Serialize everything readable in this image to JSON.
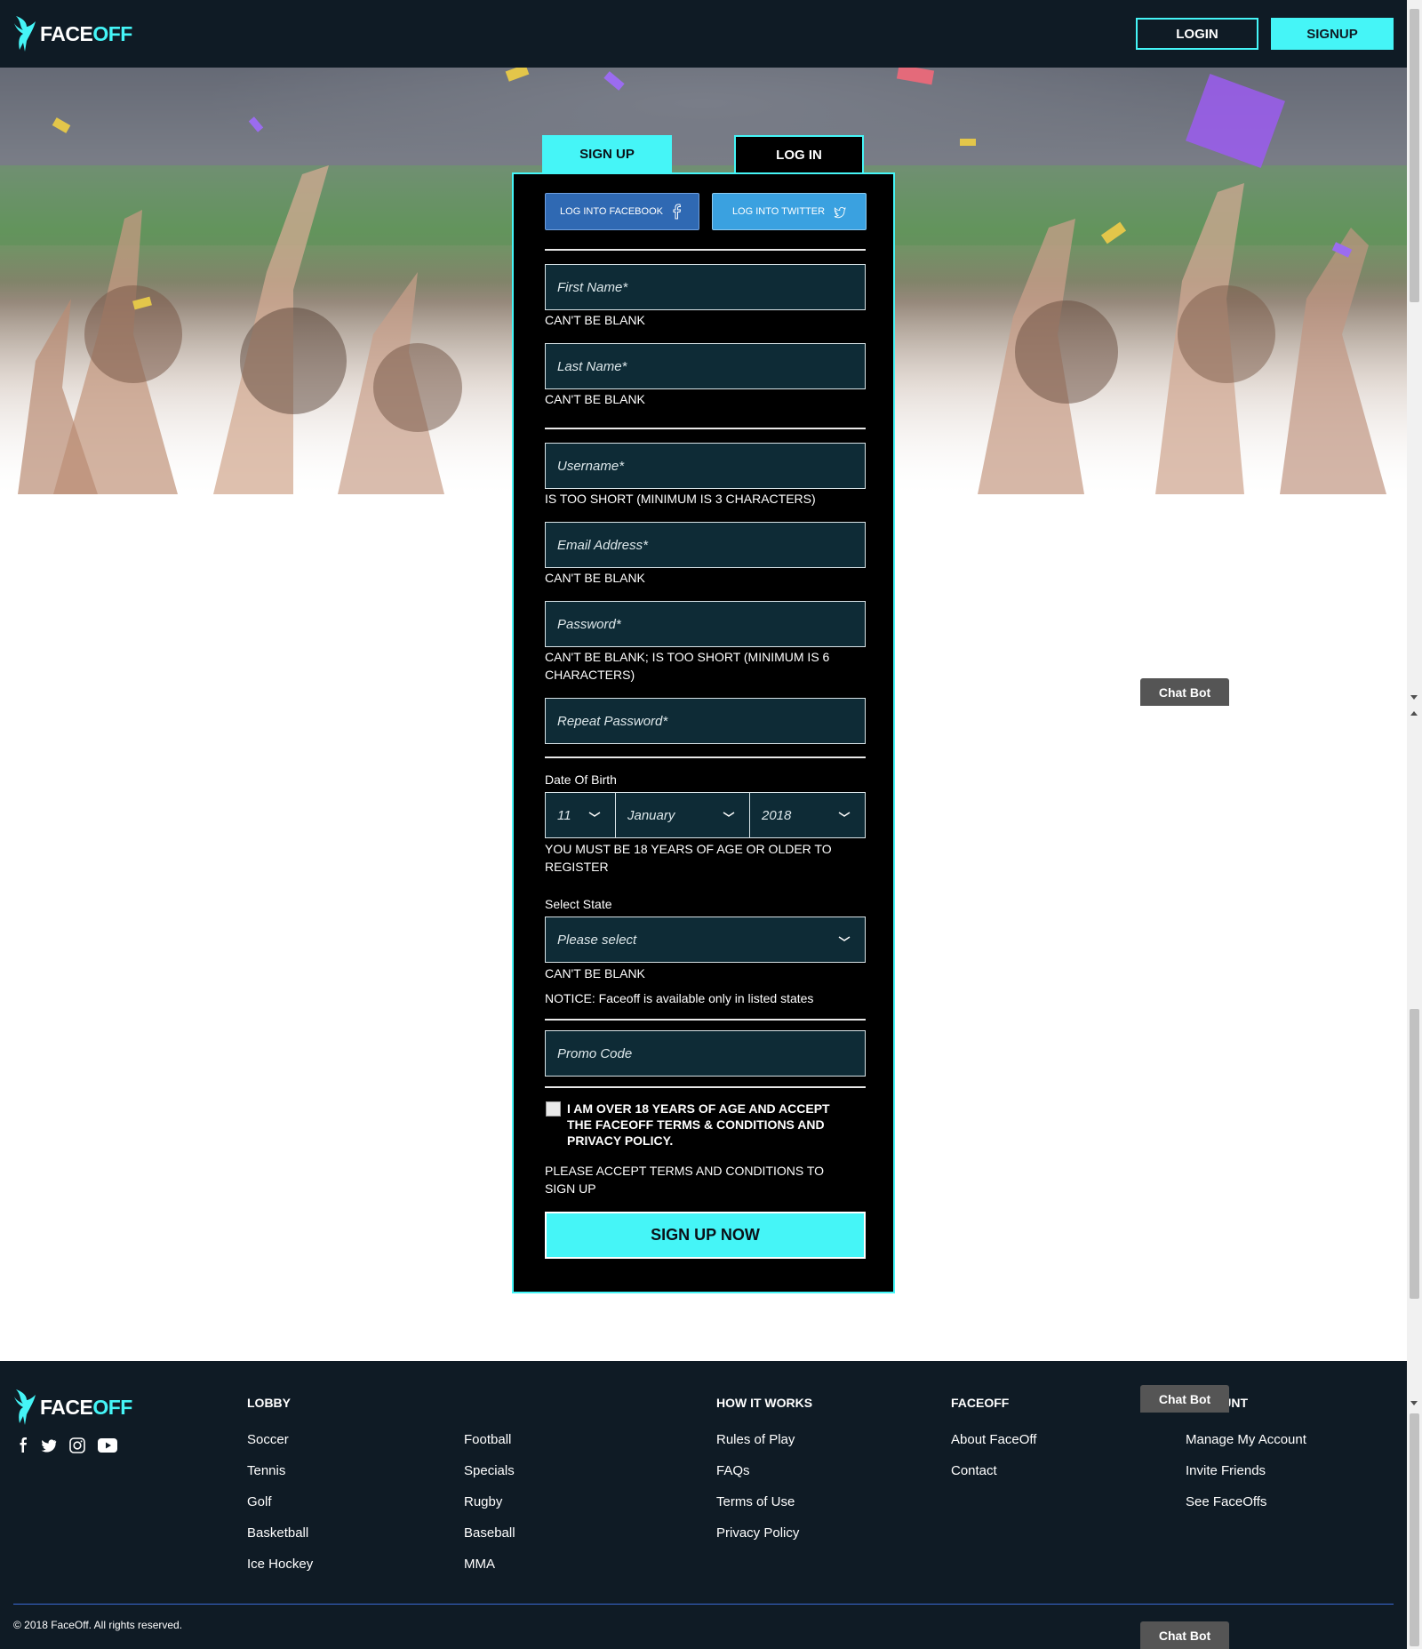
{
  "header": {
    "brand_part1": "FACE",
    "brand_part2": "OFF",
    "login_label": "LOGIN",
    "signup_label": "SIGNUP"
  },
  "form": {
    "tabs": {
      "signup": "SIGN UP",
      "login": "LOG IN"
    },
    "social": {
      "facebook": "LOG INTO FACEBOOK",
      "twitter": "LOG INTO TWITTER"
    },
    "fields": {
      "first_name": {
        "placeholder": "First Name*",
        "error": "CAN'T BE BLANK"
      },
      "last_name": {
        "placeholder": "Last Name*",
        "error": "CAN'T BE BLANK"
      },
      "username": {
        "placeholder": "Username*",
        "error": "IS TOO SHORT (MINIMUM IS 3 CHARACTERS)"
      },
      "email": {
        "placeholder": "Email Address*",
        "error": "CAN'T BE BLANK"
      },
      "password": {
        "placeholder": "Password*",
        "error": "CAN'T BE BLANK; IS TOO SHORT (MINIMUM IS 6 CHARACTERS)"
      },
      "repeat_password": {
        "placeholder": "Repeat Password*"
      }
    },
    "dob": {
      "label": "Date Of Birth",
      "day": "11",
      "month": "January",
      "year": "2018",
      "error": "YOU MUST BE 18 YEARS OF AGE OR OLDER TO REGISTER"
    },
    "state": {
      "label": "Select State",
      "placeholder": "Please select",
      "error": "CAN'T BE BLANK",
      "notice": "NOTICE: Faceoff is available only in listed states"
    },
    "promo_placeholder": "Promo Code",
    "terms_text": "I AM OVER 18 YEARS OF AGE AND ACCEPT THE FACEOFF TERMS & CONDITIONS AND PRIVACY POLICY.",
    "terms_error": "PLEASE ACCEPT TERMS AND CONDITIONS TO SIGN UP",
    "submit_label": "SIGN UP NOW"
  },
  "chatbot_label": "Chat Bot",
  "footer": {
    "brand_part1": "FACE",
    "brand_part2": "OFF",
    "social_icons": [
      "facebook-icon",
      "twitter-icon",
      "instagram-icon",
      "youtube-icon"
    ],
    "lobby": {
      "heading": "LOBBY",
      "col1": [
        "Soccer",
        "Tennis",
        "Golf",
        "Basketball",
        "Ice Hockey"
      ],
      "col2": [
        "Football",
        "Specials",
        "Rugby",
        "Baseball",
        "MMA"
      ]
    },
    "how_it_works": {
      "heading": "HOW IT WORKS",
      "links": [
        "Rules of Play",
        "FAQs",
        "Terms of Use",
        "Privacy Policy"
      ]
    },
    "faceoff": {
      "heading": "FACEOFF",
      "links": [
        "About FaceOff",
        "Contact"
      ]
    },
    "account": {
      "heading": "ACCOUNT",
      "links": [
        "Manage My Account",
        "Invite Friends",
        "See FaceOffs"
      ]
    },
    "copyright": "© 2018 FaceOff. All rights reserved."
  },
  "colors": {
    "accent": "#45f5f7",
    "navy": "#0f1b25",
    "field_bg": "#0e2b36",
    "facebook": "#2f69b3",
    "twitter": "#3aa1e0"
  }
}
